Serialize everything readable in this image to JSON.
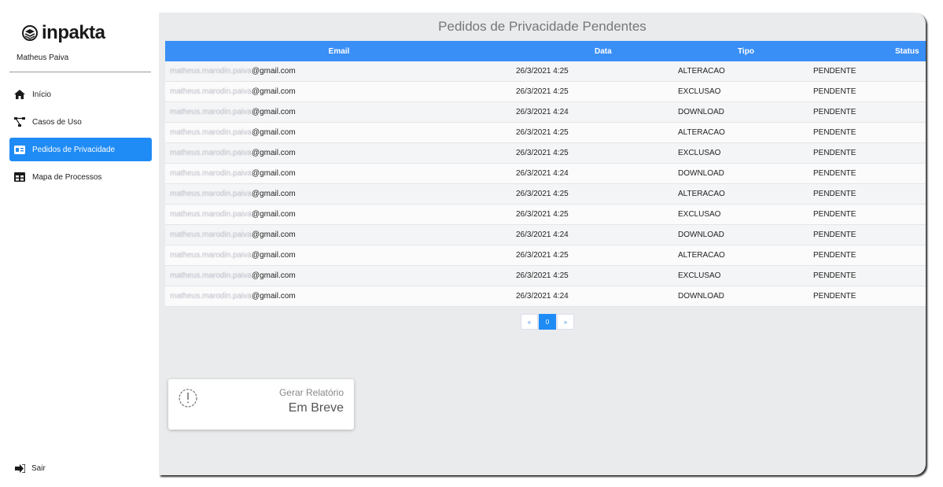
{
  "app": {
    "logo_text": "inpakta"
  },
  "user": {
    "name": "Matheus Paiva"
  },
  "sidebar": {
    "items": [
      {
        "label": "Início",
        "icon": "home-icon",
        "active": false
      },
      {
        "label": "Casos de Uso",
        "icon": "diagram-icon",
        "active": false
      },
      {
        "label": "Pedidos de Privacidade",
        "icon": "id-card-icon",
        "active": true
      },
      {
        "label": "Mapa de Processos",
        "icon": "table-icon",
        "active": false
      }
    ],
    "logout_label": "Sair"
  },
  "main": {
    "title": "Pedidos de Privacidade Pendentes",
    "columns": {
      "email": "Email",
      "data": "Data",
      "tipo": "Tipo",
      "status": "Status"
    },
    "rows": [
      {
        "email_user": "matheus.marodin.paiva",
        "email_domain": "@gmail.com",
        "data": "26/3/2021 4:25",
        "tipo": "ALTERACAO",
        "status": "PENDENTE"
      },
      {
        "email_user": "matheus.marodin.paiva",
        "email_domain": "@gmail.com",
        "data": "26/3/2021 4:25",
        "tipo": "EXCLUSAO",
        "status": "PENDENTE"
      },
      {
        "email_user": "matheus.marodin.paiva",
        "email_domain": "@gmail.com",
        "data": "26/3/2021 4:24",
        "tipo": "DOWNLOAD",
        "status": "PENDENTE"
      },
      {
        "email_user": "matheus.marodin.paiva",
        "email_domain": "@gmail.com",
        "data": "26/3/2021 4:25",
        "tipo": "ALTERACAO",
        "status": "PENDENTE"
      },
      {
        "email_user": "matheus.marodin.paiva",
        "email_domain": "@gmail.com",
        "data": "26/3/2021 4:25",
        "tipo": "EXCLUSAO",
        "status": "PENDENTE"
      },
      {
        "email_user": "matheus.marodin.paiva",
        "email_domain": "@gmail.com",
        "data": "26/3/2021 4:24",
        "tipo": "DOWNLOAD",
        "status": "PENDENTE"
      },
      {
        "email_user": "matheus.marodin.paiva",
        "email_domain": "@gmail.com",
        "data": "26/3/2021 4:25",
        "tipo": "ALTERACAO",
        "status": "PENDENTE"
      },
      {
        "email_user": "matheus.marodin.paiva",
        "email_domain": "@gmail.com",
        "data": "26/3/2021 4:25",
        "tipo": "EXCLUSAO",
        "status": "PENDENTE"
      },
      {
        "email_user": "matheus.marodin.paiva",
        "email_domain": "@gmail.com",
        "data": "26/3/2021 4:24",
        "tipo": "DOWNLOAD",
        "status": "PENDENTE"
      },
      {
        "email_user": "matheus.marodin.paiva",
        "email_domain": "@gmail.com",
        "data": "26/3/2021 4:25",
        "tipo": "ALTERACAO",
        "status": "PENDENTE"
      },
      {
        "email_user": "matheus.marodin.paiva",
        "email_domain": "@gmail.com",
        "data": "26/3/2021 4:25",
        "tipo": "EXCLUSAO",
        "status": "PENDENTE"
      },
      {
        "email_user": "matheus.marodin.paiva",
        "email_domain": "@gmail.com",
        "data": "26/3/2021 4:24",
        "tipo": "DOWNLOAD",
        "status": "PENDENTE"
      }
    ],
    "pagination": {
      "prev": "«",
      "current": "0",
      "next": "»"
    },
    "report_card": {
      "label": "Gerar Relatório",
      "value": "Em Breve",
      "icon": "alert-circle-icon"
    }
  },
  "colors": {
    "accent": "#1f8bf5",
    "header": "#3a8ff7",
    "panel": "#e9ebed"
  }
}
